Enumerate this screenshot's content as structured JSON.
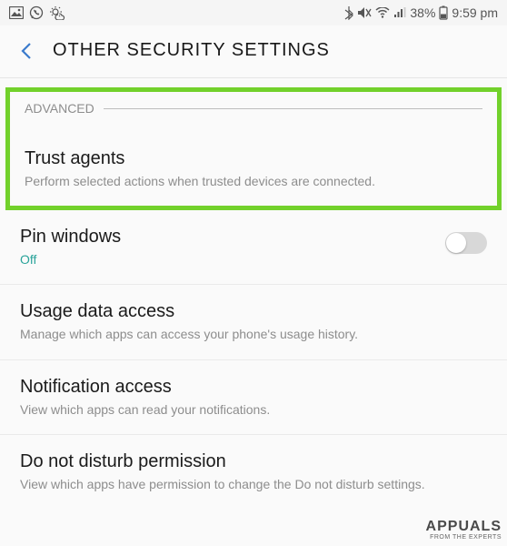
{
  "statusbar": {
    "battery_pct": "38%",
    "time": "9:59 pm"
  },
  "header": {
    "title": "OTHER SECURITY SETTINGS"
  },
  "section": {
    "advanced_label": "ADVANCED"
  },
  "rows": {
    "trust_agents": {
      "title": "Trust agents",
      "subtitle": "Perform selected actions when trusted devices are connected."
    },
    "pin_windows": {
      "title": "Pin windows",
      "subtitle": "Off"
    },
    "usage_data": {
      "title": "Usage data access",
      "subtitle": "Manage which apps can access your phone's usage history."
    },
    "notification_access": {
      "title": "Notification access",
      "subtitle": "View which apps can read your notifications."
    },
    "dnd_permission": {
      "title": "Do not disturb permission",
      "subtitle": "View which apps have permission to change the Do not disturb settings."
    }
  },
  "watermark": {
    "brand": "APPUALS",
    "tagline": "FROM THE EXPERTS"
  }
}
